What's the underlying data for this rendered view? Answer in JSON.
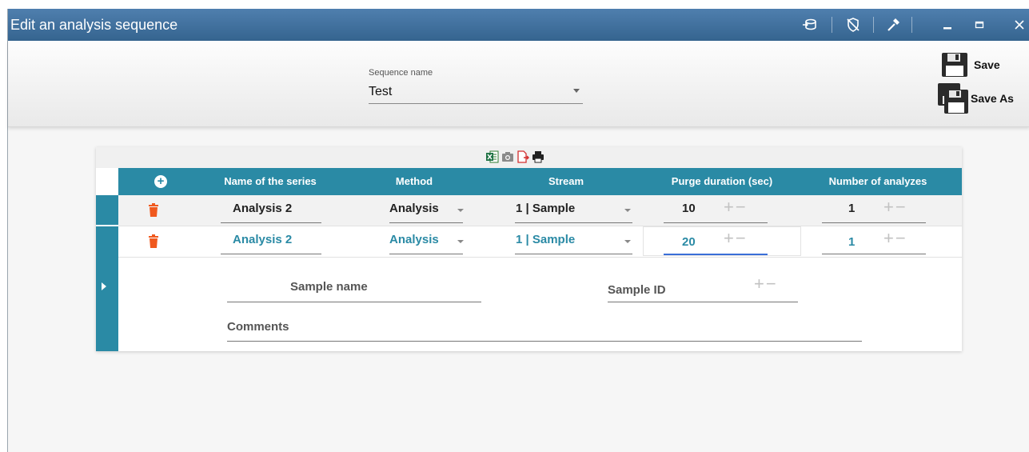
{
  "window": {
    "title": "Edit an analysis sequence",
    "controls": [
      "db-icon",
      "shield-icon",
      "hammer-icon",
      "minimize-icon",
      "maximize-icon",
      "close-icon"
    ]
  },
  "header": {
    "sequence_label": "Sequence name",
    "sequence_value": "Test",
    "save_label": "Save",
    "save_as_label": "Save As"
  },
  "export_icons": [
    "excel-icon",
    "camera-icon",
    "pdf-export-icon",
    "print-icon"
  ],
  "table": {
    "columns": [
      "Name of the series",
      "Method",
      "Stream",
      "Purge duration (sec)",
      "Number of analyzes"
    ],
    "rows": [
      {
        "name": "Analysis 2",
        "method": "Analysis",
        "stream": "1 | Sample",
        "purge": "10",
        "count": "1"
      },
      {
        "name": "Analysis 2",
        "method": "Analysis",
        "stream": "1 | Sample",
        "purge": "20",
        "count": "1"
      }
    ],
    "plus_minus": "+−"
  },
  "details": {
    "sample_name_label": "Sample name",
    "sample_id_label": "Sample ID",
    "comments_label": "Comments"
  },
  "colors": {
    "accent": "#2a8aa5",
    "delete": "#f0591e",
    "titlebar": "#3c6c97"
  }
}
